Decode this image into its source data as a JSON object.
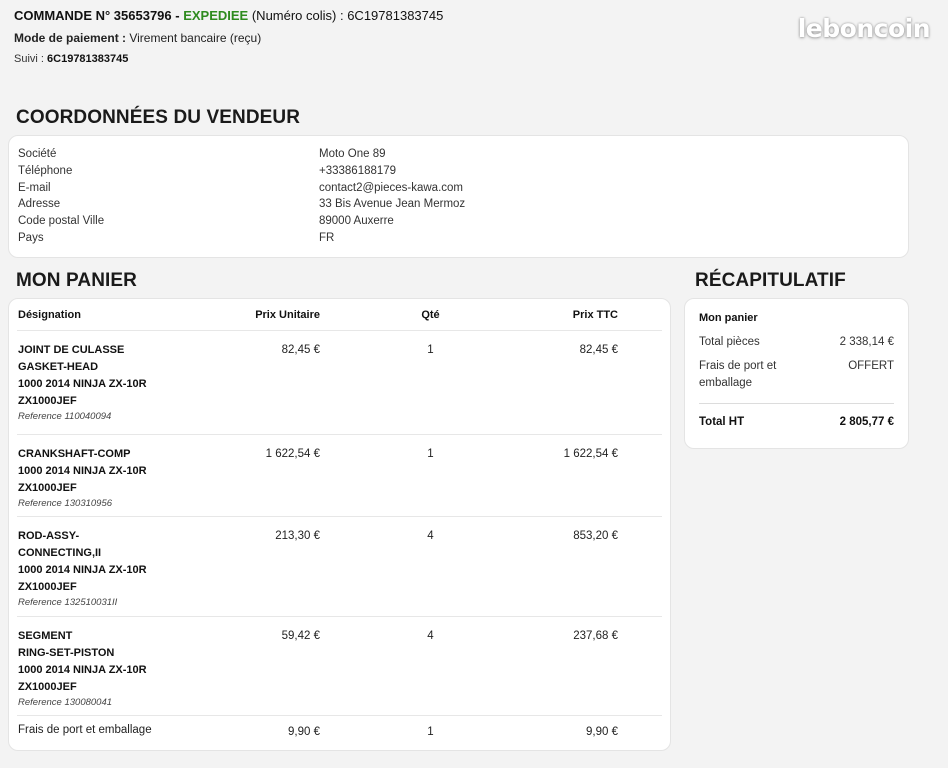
{
  "order": {
    "title_prefix": "COMMANDE N° 35653796 - ",
    "status": "EXPEDIEE",
    "parcel_note": " (Numéro colis) : 6C19781383745",
    "payment_label": "Mode de paiement :",
    "payment_value": " Virement bancaire (reçu)",
    "tracking_label": "Suivi : ",
    "tracking_value": "6C19781383745"
  },
  "brand": {
    "logo_text": "leboncoin"
  },
  "seller": {
    "section_title": "COORDONNÉES DU VENDEUR",
    "rows": [
      {
        "label": "Société",
        "value": "Moto One 89"
      },
      {
        "label": "Téléphone",
        "value": "+33386188179"
      },
      {
        "label": "E-mail",
        "value": "contact2@pieces-kawa.com"
      },
      {
        "label": "Adresse",
        "value": "33 Bis Avenue Jean Mermoz"
      },
      {
        "label": "Code postal Ville",
        "value": "89000 Auxerre"
      },
      {
        "label": "Pays",
        "value": "FR"
      }
    ]
  },
  "cart": {
    "section_title": "MON PANIER",
    "columns": {
      "designation": "Désignation",
      "unit_price": "Prix Unitaire",
      "qty": "Qté",
      "total": "Prix TTC"
    },
    "items": [
      {
        "lines": [
          "JOINT DE CULASSE",
          "GASKET-HEAD",
          "1000 2014 NINJA ZX-10R",
          "ZX1000JEF"
        ],
        "ref": "Reference 110040094",
        "unit_price": "82,45 €",
        "qty": "1",
        "total": "82,45 €"
      },
      {
        "lines": [
          "CRANKSHAFT-COMP",
          "1000 2014 NINJA ZX-10R",
          "ZX1000JEF"
        ],
        "ref": "Reference 130310956",
        "unit_price": "1 622,54 €",
        "qty": "1",
        "total": "1 622,54 €"
      },
      {
        "lines": [
          "ROD-ASSY-",
          "CONNECTING,II",
          "1000 2014 NINJA ZX-10R",
          "ZX1000JEF"
        ],
        "ref": "Reference 132510031II",
        "unit_price": "213,30 €",
        "qty": "4",
        "total": "853,20 €"
      },
      {
        "lines": [
          "SEGMENT",
          "RING-SET-PISTON",
          "1000 2014 NINJA ZX-10R",
          "ZX1000JEF"
        ],
        "ref": "Reference 130080041",
        "unit_price": "59,42 €",
        "qty": "4",
        "total": "237,68 €"
      }
    ],
    "fees": {
      "label": "Frais de port et emballage",
      "unit_price": "9,90 €",
      "qty": "1",
      "total": "9,90 €"
    }
  },
  "recap": {
    "section_title": "RÉCAPITULATIF",
    "box_title": "Mon panier",
    "parts_label": "Total pièces",
    "parts_value": "2 338,14 €",
    "shipping_label": "Frais de port et emballage",
    "shipping_value": "OFFERT",
    "total_label": "Total HT",
    "total_value": "2 805,77 €"
  }
}
